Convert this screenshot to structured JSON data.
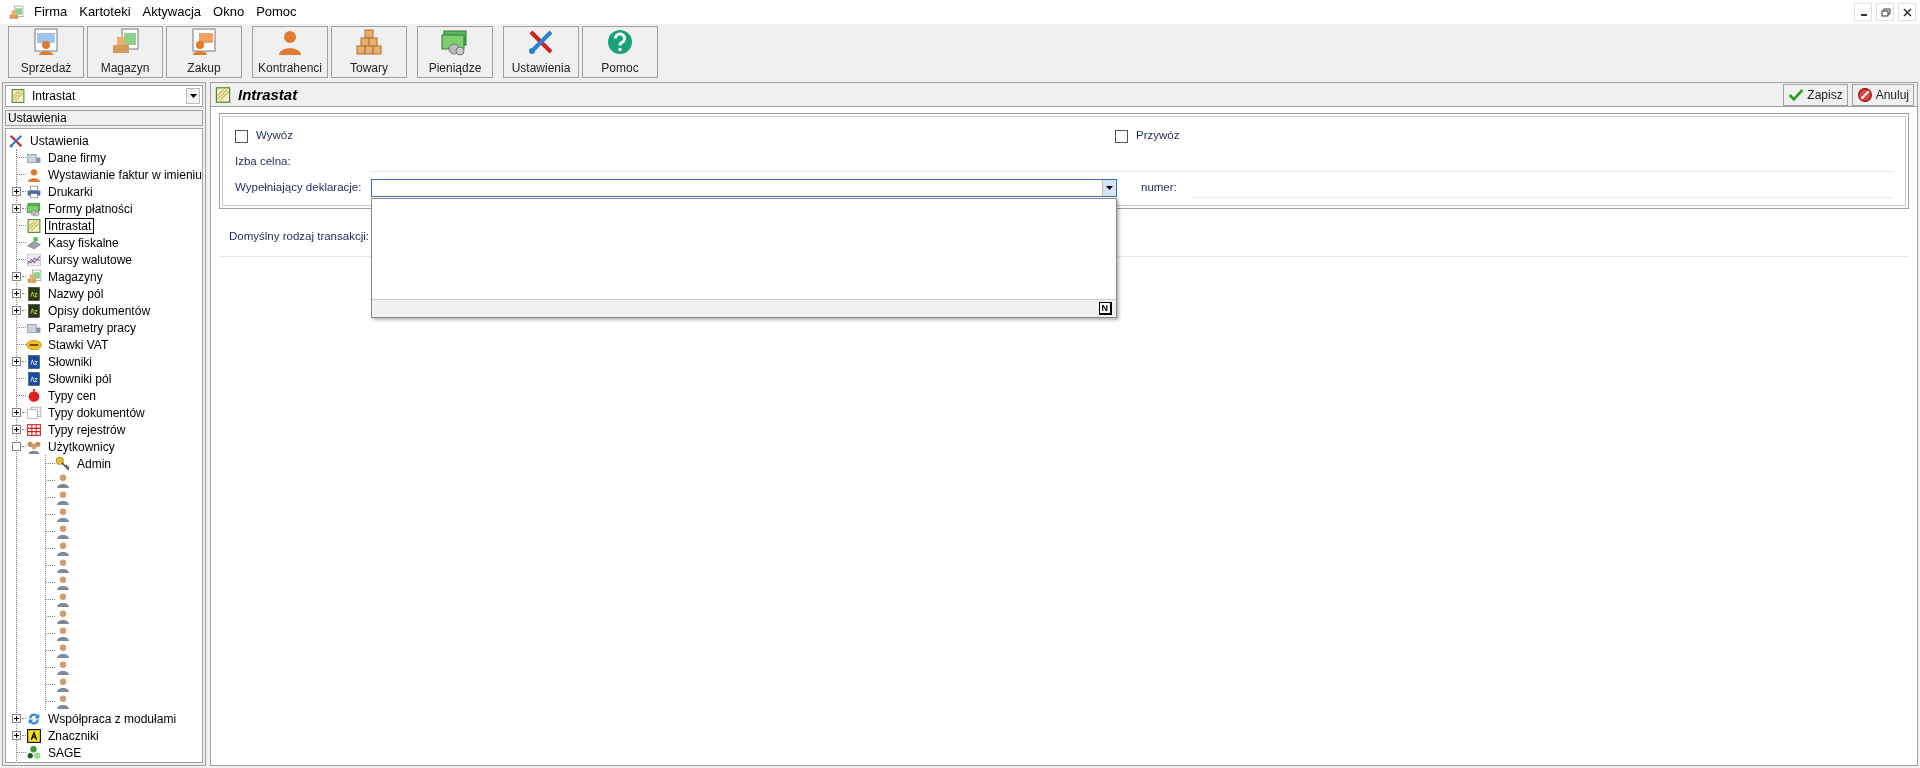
{
  "window": {
    "controls": [
      {
        "kind": "minimize"
      },
      {
        "kind": "restore"
      },
      {
        "kind": "close"
      }
    ]
  },
  "menu": [
    "Firma",
    "Kartoteki",
    "Aktywacja",
    "Okno",
    "Pomoc"
  ],
  "toolbar": [
    {
      "buttons": [
        {
          "label": "Sprzedaż",
          "kind": "sales"
        },
        {
          "label": "Magazyn",
          "kind": "warehouse"
        },
        {
          "label": "Zakup",
          "kind": "purchase"
        }
      ]
    },
    {
      "buttons": [
        {
          "label": "Kontrahenci",
          "kind": "person"
        },
        {
          "label": "Towary",
          "kind": "boxes"
        }
      ]
    },
    {
      "buttons": [
        {
          "label": "Pieniądze",
          "kind": "money"
        }
      ]
    },
    {
      "buttons": [
        {
          "label": "Ustawienia",
          "kind": "tools"
        },
        {
          "label": "Pomoc",
          "kind": "help"
        }
      ]
    }
  ],
  "sidebar": {
    "selector": {
      "value": "Intrastat",
      "kind": "intrastat"
    },
    "header": "Ustawienia",
    "tree": [
      {
        "label": "Ustawienia",
        "kind": "tools",
        "selected": false,
        "children": [
          {
            "label": "Dane firmy",
            "kind": "building",
            "selected": false
          },
          {
            "label": "Wystawianie faktur w imieniu",
            "kind": "person",
            "selected": false
          },
          {
            "label": "Drukarki",
            "kind": "printer",
            "selected": false,
            "expanded": false
          },
          {
            "label": "Formy płatności",
            "kind": "money",
            "selected": false,
            "expanded": false
          },
          {
            "label": "Intrastat",
            "kind": "intrastat",
            "selected": true
          },
          {
            "label": "Kasy fiskalne",
            "kind": "register",
            "selected": false
          },
          {
            "label": "Kursy walutowe",
            "kind": "chart",
            "selected": false
          },
          {
            "label": "Magazyny",
            "kind": "warehouse",
            "selected": false,
            "expanded": false
          },
          {
            "label": "Nazwy pól",
            "kind": "az-dark",
            "selected": false,
            "expanded": false
          },
          {
            "label": "Opisy dokumentów",
            "kind": "az-dark",
            "selected": false,
            "expanded": false
          },
          {
            "label": "Parametry pracy",
            "kind": "building",
            "selected": false
          },
          {
            "label": "Stawki VAT",
            "kind": "vat",
            "selected": false
          },
          {
            "label": "Słowniki",
            "kind": "az-blue",
            "selected": false,
            "expanded": false
          },
          {
            "label": "Słowniki pól",
            "kind": "az-blue",
            "selected": false
          },
          {
            "label": "Typy cen",
            "kind": "red-dot",
            "selected": false
          },
          {
            "label": "Typy dokumentów",
            "kind": "docs",
            "selected": false,
            "expanded": false
          },
          {
            "label": "Typy rejestrów",
            "kind": "grid",
            "selected": false,
            "expanded": false
          },
          {
            "label": "Użytkownicy",
            "kind": "users",
            "selected": false,
            "expanded": true,
            "children": [
              {
                "label": "Admin",
                "kind": "key",
                "selected": false
              },
              {
                "kind": "user",
                "selected": false
              },
              {
                "kind": "user",
                "selected": false
              },
              {
                "kind": "user",
                "selected": false
              },
              {
                "kind": "user",
                "selected": false
              },
              {
                "kind": "user",
                "selected": false
              },
              {
                "kind": "user",
                "selected": false
              },
              {
                "kind": "user",
                "selected": false
              },
              {
                "kind": "user",
                "selected": false
              },
              {
                "kind": "user",
                "selected": false
              },
              {
                "kind": "user",
                "selected": false
              },
              {
                "kind": "user",
                "selected": false
              },
              {
                "kind": "user",
                "selected": false
              },
              {
                "kind": "user",
                "selected": false
              },
              {
                "kind": "user",
                "selected": false
              }
            ]
          },
          {
            "label": "Współpraca z modułami",
            "kind": "sync",
            "selected": false,
            "expanded": false
          },
          {
            "label": "Znaczniki",
            "kind": "tag",
            "selected": false,
            "expanded": false
          },
          {
            "label": "SAGE",
            "kind": "sage",
            "selected": false
          }
        ]
      }
    ]
  },
  "panel": {
    "title": "Intrastat",
    "kind": "intrastat",
    "actions": [
      {
        "label": "Zapisz",
        "kind": "ok"
      },
      {
        "label": "Anuluj",
        "kind": "cancel"
      }
    ],
    "checkboxes": [
      {
        "label": "Wywóz",
        "checked": false
      },
      {
        "label": "Przywóz",
        "checked": false
      }
    ],
    "customs_office": {
      "label": "Izba celna:"
    },
    "declarant": {
      "label": "Wypełniający deklaracje:",
      "expanded": true,
      "popup_footer": "N"
    },
    "number": {
      "label": "numer:"
    },
    "transaction_type": {
      "label": "Domyślny rodzaj transakcji:"
    }
  }
}
